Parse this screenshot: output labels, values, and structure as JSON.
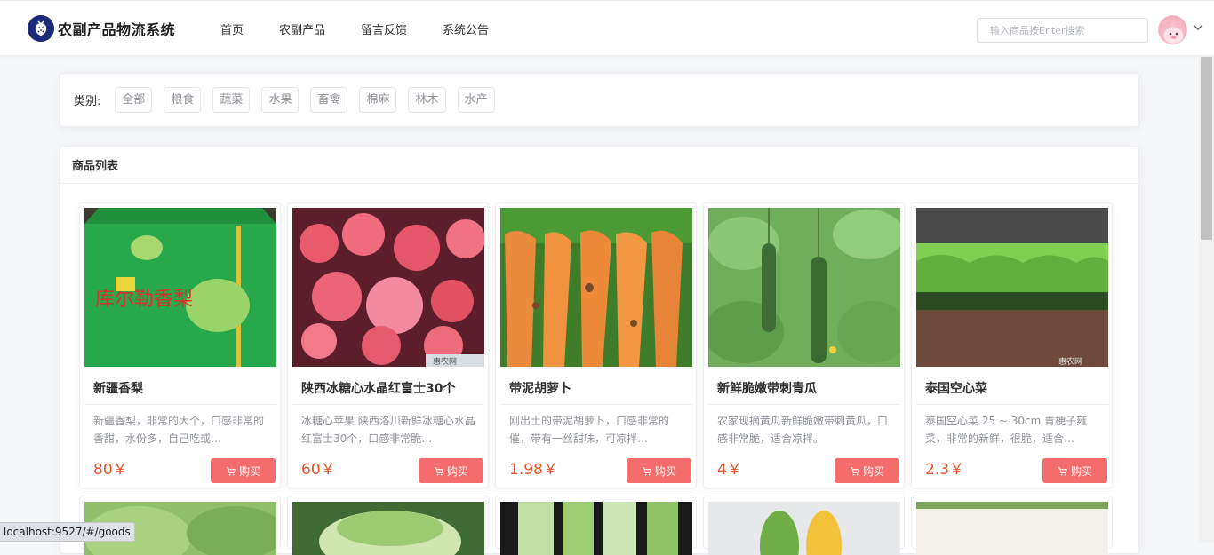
{
  "header": {
    "app_title": "农副产品物流系统",
    "nav": [
      "首页",
      "农副产品",
      "留言反馈",
      "系统公告"
    ],
    "search_placeholder": "输入商品按Enter搜索"
  },
  "category": {
    "label": "类别:",
    "tags": [
      "全部",
      "粮食",
      "蔬菜",
      "水果",
      "畜禽",
      "棉麻",
      "林木",
      "水产"
    ]
  },
  "list": {
    "title": "商品列表",
    "buy_label": "购买",
    "items": [
      {
        "name": "新疆香梨",
        "desc": "新疆香梨，非常的大个，口感非常的香甜，水份多，自己吃或…",
        "price": "80￥"
      },
      {
        "name": "陕西冰糖心水晶红富士30个",
        "desc": "冰糖心苹果 陕西洛川新鲜冰糖心水晶红富士30个，口感非常脆…",
        "price": "60￥"
      },
      {
        "name": "带泥胡萝卜",
        "desc": "刚出土的带泥胡萝卜，口感非常的催，带有一丝甜味，可凉拌…",
        "price": "1.98￥"
      },
      {
        "name": "新鲜脆嫩带刺青瓜",
        "desc": "农家现摘黄瓜新鲜脆嫩带刺黄瓜，口感非常脆，适合凉拌。",
        "price": "4￥"
      },
      {
        "name": "泰国空心菜",
        "desc": "泰国空心菜 25 ~ 30cm 青梗子雍菜，非常的新鲜，很脆，适合…",
        "price": "2.3￥"
      }
    ]
  },
  "status_url": "localhost:9527/#/goods",
  "colors": {
    "accent": "#f56c6c",
    "price": "#e6562b",
    "logo_bg": "#1c2a78"
  }
}
